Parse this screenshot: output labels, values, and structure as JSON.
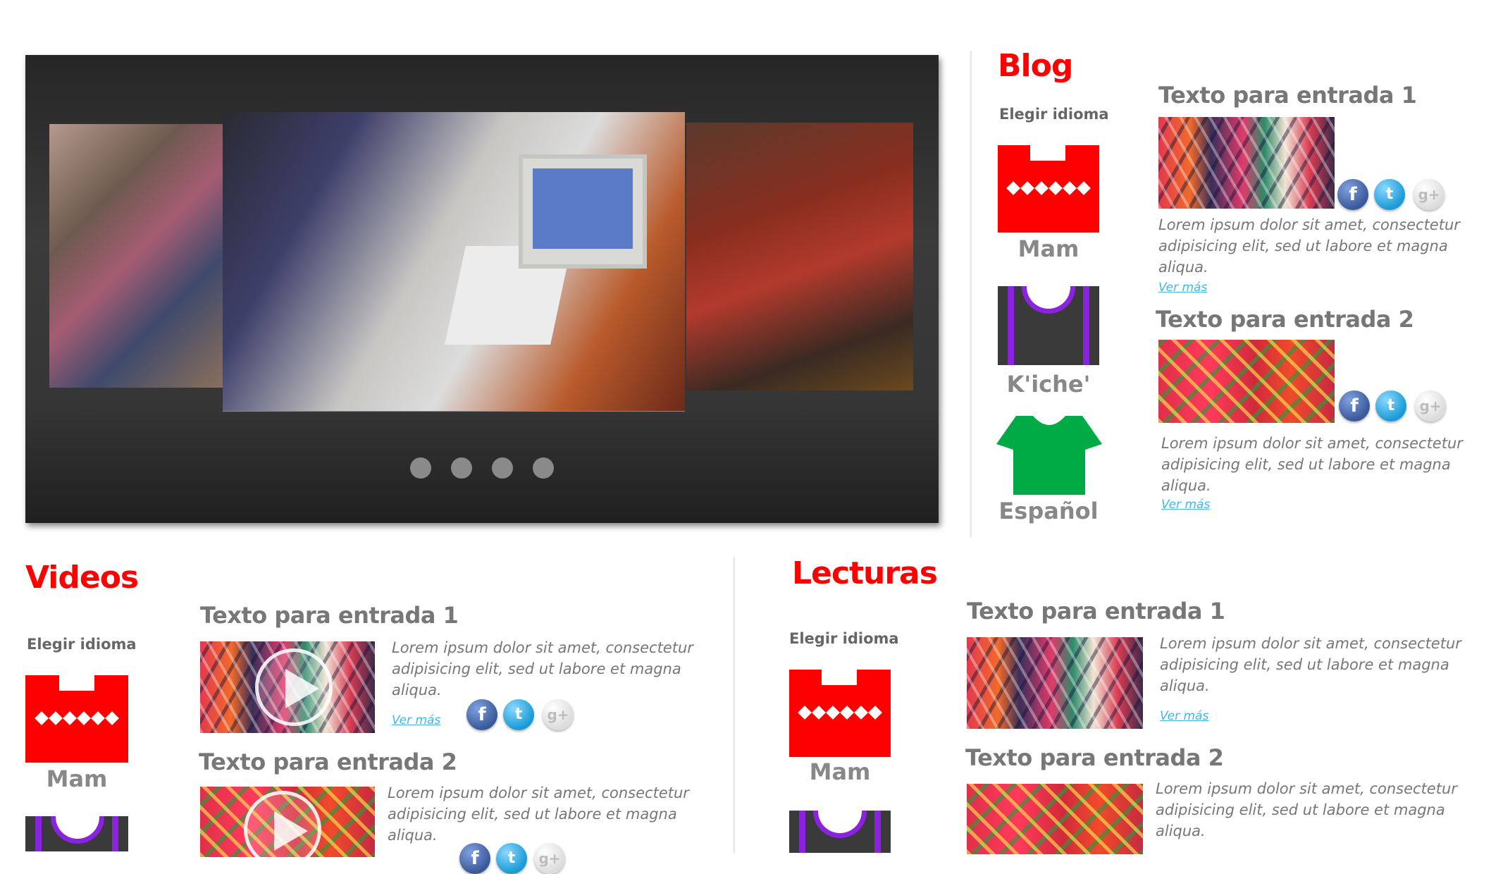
{
  "slider": {
    "photos": [
      "photo-left",
      "photo-main",
      "photo-right"
    ],
    "dot_count": 4
  },
  "blog": {
    "title": "Blog",
    "choose_language": "Elegir idioma",
    "languages": [
      "Mam",
      "K'iche'",
      "Español"
    ],
    "entries": [
      {
        "title": "Texto para entrada 1",
        "text": "Lorem ipsum dolor sit amet, consectetur adipisicing elit, sed ut labore et  magna aliqua.",
        "more": "Ver más"
      },
      {
        "title": "Texto para entrada 2",
        "text": "Lorem ipsum dolor sit amet, consectetur adipisicing elit, sed ut labore et  magna aliqua.",
        "more": "Ver más"
      }
    ]
  },
  "videos": {
    "title": "Videos",
    "choose_language": "Elegir idioma",
    "languages": [
      "Mam"
    ],
    "entries": [
      {
        "title": "Texto para entrada 1",
        "text": "Lorem ipsum dolor sit amet, consectetur adipisicing elit, sed ut labore et  magna aliqua.",
        "more": "Ver más"
      },
      {
        "title": "Texto para entrada 2",
        "text": "Lorem ipsum dolor sit amet, consectetur adipisicing elit, sed ut labore et  magna aliqua."
      }
    ]
  },
  "lecturas": {
    "title": "Lecturas",
    "choose_language": "Elegir idioma",
    "languages": [
      "Mam"
    ],
    "entries": [
      {
        "title": "Texto para entrada 1",
        "text": "Lorem ipsum dolor sit amet, consectetur adipisicing elit, sed ut labore et  magna aliqua.",
        "more": "Ver más"
      },
      {
        "title": "Texto para entrada 2",
        "text": "Lorem ipsum dolor sit amet, consectetur adipisicing elit, sed ut labore et  magna aliqua."
      }
    ]
  },
  "social": {
    "facebook": "f",
    "twitter": "t",
    "googleplus": "g+"
  },
  "colors": {
    "section_title": "#ff0000",
    "mam_shirt": "#ff0000",
    "kiche_shirt": "#3a3a3a",
    "kiche_accent": "#8a22e0",
    "espanol_shirt": "#00aa44",
    "link": "#3fb8e8"
  }
}
